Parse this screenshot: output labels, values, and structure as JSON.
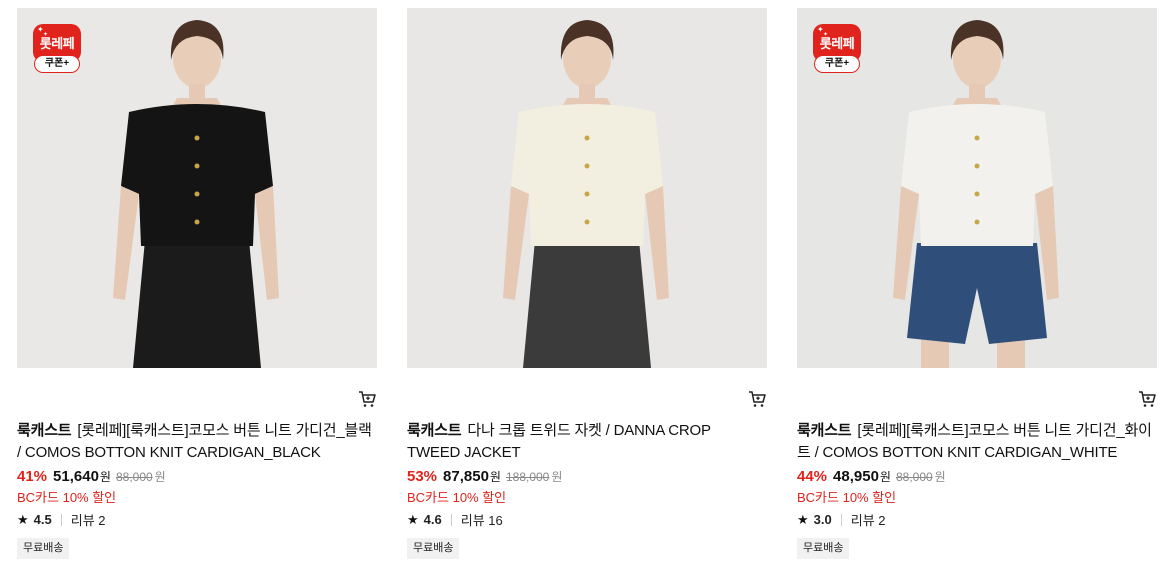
{
  "products": [
    {
      "has_badge": true,
      "badge": {
        "main": "롯레페",
        "coupon": "쿠폰+"
      },
      "brand": "룩캐스트",
      "name": "[롯레페][룩캐스트]코모스 버튼 니트 가디건_블랙 / COMOS BOTTON KNIT CARDIGAN_BLACK",
      "discount": "41%",
      "price": "51,640",
      "currency": "원",
      "original_price": "88,000",
      "original_currency": "원",
      "card_discount": "BC카드 10% 할인",
      "rating": "4.5",
      "review_label": "리뷰 2",
      "shipping": "무료배송",
      "colors": {
        "top": "#141414",
        "bottom": "#1b1b1b",
        "bg": "#e9e8e6"
      }
    },
    {
      "has_badge": false,
      "brand": "룩캐스트",
      "name": "다나 크롭 트위드 자켓 / DANNA CROP TWEED JACKET",
      "discount": "53%",
      "price": "87,850",
      "currency": "원",
      "original_price": "188,000",
      "original_currency": "원",
      "card_discount": "BC카드 10% 할인",
      "rating": "4.6",
      "review_label": "리뷰 16",
      "shipping": "무료배송",
      "colors": {
        "top": "#f3efe0",
        "bottom": "#3b3b3b",
        "bg": "#e8e7e5"
      }
    },
    {
      "has_badge": true,
      "badge": {
        "main": "롯레페",
        "coupon": "쿠폰+"
      },
      "brand": "룩캐스트",
      "name": "[롯레페][룩캐스트]코모스 버튼 니트 가디건_화이트 / COMOS BOTTON KNIT CARDIGAN_WHITE",
      "discount": "44%",
      "price": "48,950",
      "currency": "원",
      "original_price": "88,000",
      "original_currency": "원",
      "card_discount": "BC카드 10% 할인",
      "rating": "3.0",
      "review_label": "리뷰 2",
      "shipping": "무료배송",
      "colors": {
        "top": "#f2f1ee",
        "bottom": "#2f4f7a",
        "bg": "#e6e6e4"
      }
    }
  ],
  "icons": {
    "cart": "cart-icon",
    "star": "star-icon"
  },
  "accent": "#e0231c"
}
